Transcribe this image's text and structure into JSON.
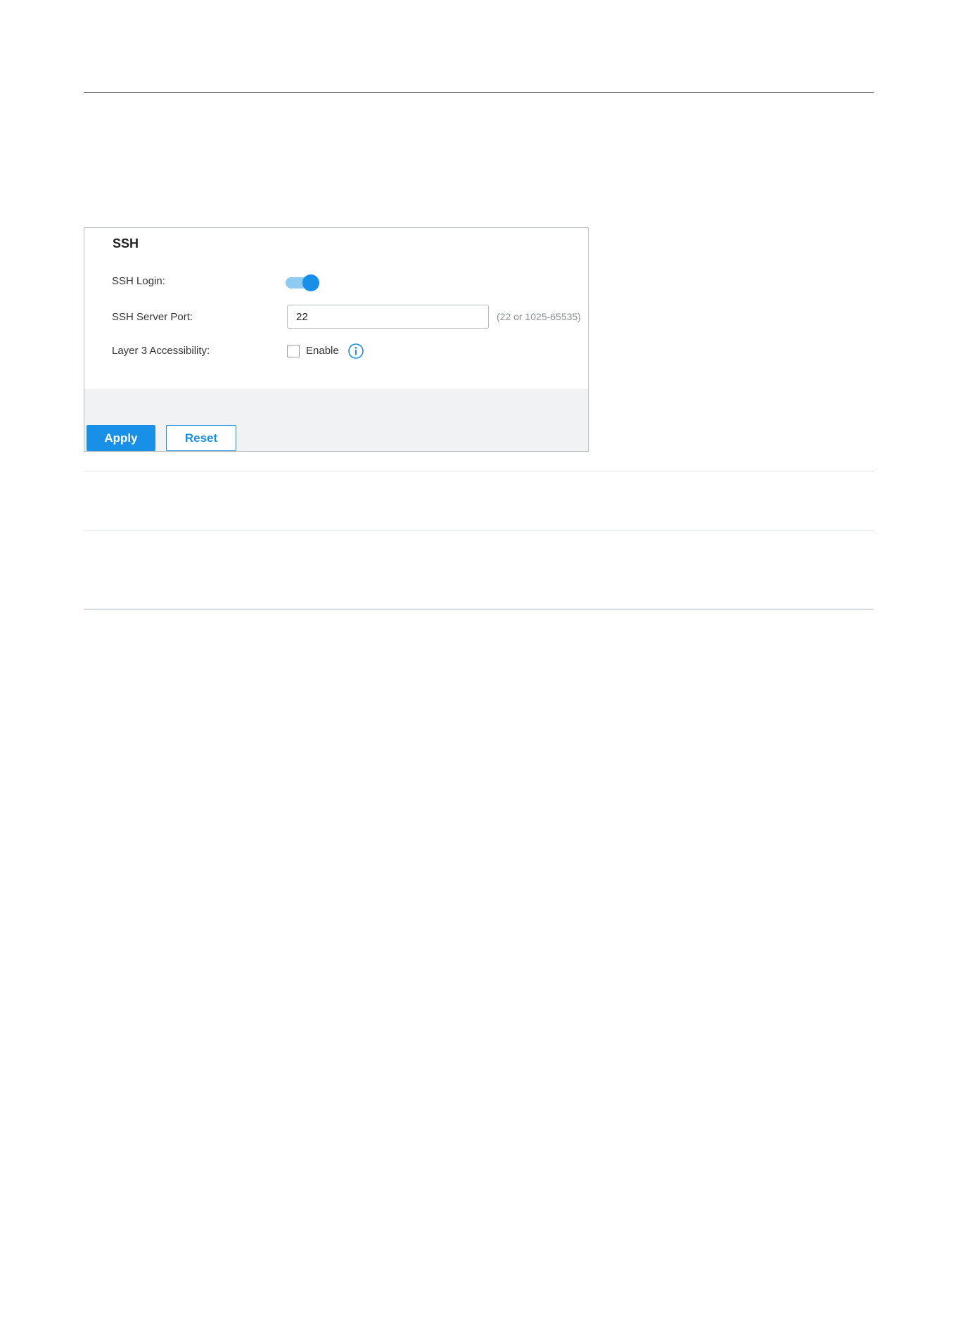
{
  "ssh_panel": {
    "title": "SSH",
    "fields": {
      "ssh_login_label": "SSH Login:",
      "ssh_login_enabled": true,
      "ssh_server_port_label": "SSH Server Port:",
      "ssh_server_port_value": "22",
      "ssh_server_port_hint": "(22 or 1025-65535)",
      "layer3_label": "Layer 3 Accessibility:",
      "layer3_enable_label": "Enable",
      "layer3_enabled": false
    },
    "buttons": {
      "apply_label": "Apply",
      "reset_label": "Reset"
    }
  },
  "colors": {
    "accent": "#1890e8",
    "toggle_track": "#8fcaf3",
    "footer_bg": "#f1f2f4",
    "hint_text": "#8a8f94"
  },
  "icons": {
    "info": "info-circle-icon"
  }
}
